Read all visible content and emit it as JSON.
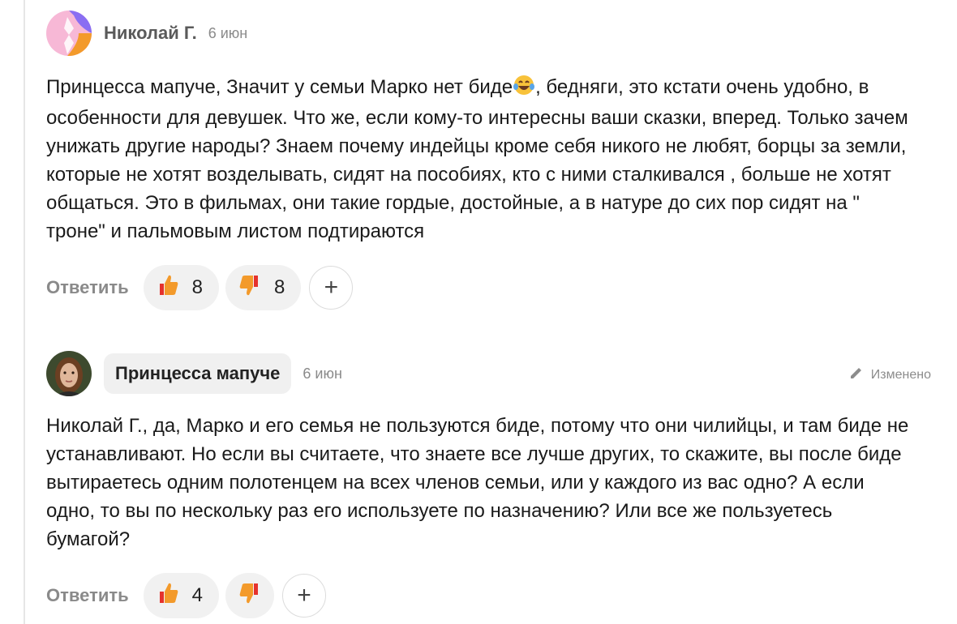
{
  "comments": [
    {
      "author": "Николай Г.",
      "date": "6 июн",
      "text_before_emoji": "Принцесса мапуче, Значит у семьи Марко нет биде",
      "text_after_emoji": ", бедняги, это кстати очень удобно, в особенности для девушек. Что же, если кому-то интересны ваши сказки, вперед. Только зачем унижать другие народы? Знаем почему индейцы кроме себя никого не любят, борцы за земли, которые не хотят возделывать, сидят на пособиях, кто с ними сталкивался , больше не хотят общаться. Это в фильмах, они такие гордые, достойные, а в натуре до сих пор сидят на \" троне\" и пальмовым листом подтираются",
      "emoji": "joy-emoji",
      "reply_label": "Ответить",
      "likes": "8",
      "dislikes": "8",
      "add_reaction": "+"
    },
    {
      "author": "Принцесса мапуче",
      "date": "6 июн",
      "edited_label": "Изменено",
      "text": "Николай Г., да, Марко и его семья не пользуются биде, потому что они чилийцы, и там биде не устанавливают. Но если вы считаете, что знаете все лучше других, то скажите, вы после биде вытираетесь одним полотенцем на всех членов семьи, или у каждого из вас одно? А если одно, то вы по нескольку раз его используете по назначению? Или все же пользуетесь бумагой?",
      "reply_label": "Ответить",
      "likes": "4",
      "dislikes": "",
      "add_reaction": "+"
    }
  ],
  "colors": {
    "accent_orange": "#f39a2b",
    "dislike_red": "#e5322d",
    "avatar_pink": "#f7b8d6",
    "avatar_purple": "#8a6ef2"
  }
}
